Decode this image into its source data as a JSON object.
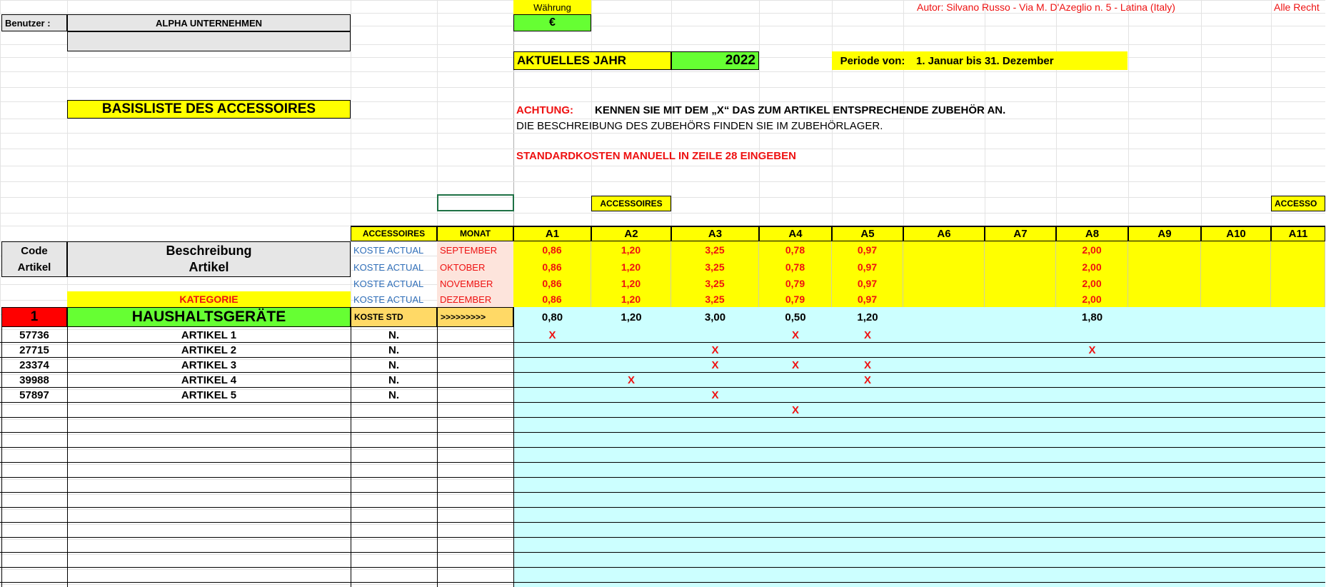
{
  "header": {
    "user_label": "Benutzer :",
    "company": "ALPHA UNTERNEHMEN",
    "currency_label": "Währung",
    "currency_value": "€",
    "author": "Autor: Silvano Russo - Via M. D'Azeglio n. 5 - Latina (Italy)",
    "rights": "Alle Recht",
    "year_label": "AKTUELLES JAHR",
    "year_value": "2022",
    "period_label": "Periode von:",
    "period_value": "1. Januar bis 31. Dezember",
    "list_title": "BASISLISTE DES ACCESSOIRES",
    "warning_label": "ACHTUNG:",
    "warning_text": "KENNEN SIE MIT DEM „X“ DAS ZUM ARTIKEL ENTSPRECHENDE ZUBEHÖR AN.",
    "info_text": "DIE BESCHREIBUNG DES ZUBEHÖRS FINDEN SIE IM ZUBEHÖRLAGER.",
    "std_cost_note": "STANDARDKOSTEN MANUELL IN ZEILE 28 EINGEBEN",
    "accessories_tag": "ACCESSOIRES",
    "accessories_tag_2": "ACCESSO"
  },
  "table": {
    "code_header_1": "Code",
    "code_header_2": "Artikel",
    "desc_header_1": "Beschreibung",
    "desc_header_2": "Artikel",
    "acc_header": "ACCESSOIRES",
    "month_header": "MONAT",
    "category_label": "KATEGORIE",
    "category_num": "1",
    "category_name": "HAUSHALTSGERÄTE",
    "std_label": "KOSTE STD",
    "std_arrow": ">>>>>>>>>",
    "acc_cols": [
      "A1",
      "A2",
      "A3",
      "A4",
      "A5",
      "A6",
      "A7",
      "A8",
      "A9",
      "A10",
      "A11"
    ],
    "cost_rows": [
      {
        "type": "KOSTE ACTUAL",
        "month": "SEPTEMBER",
        "values": [
          "0,86",
          "1,20",
          "3,25",
          "0,78",
          "0,97",
          "",
          "",
          "2,00",
          "",
          "",
          ""
        ]
      },
      {
        "type": "KOSTE ACTUAL",
        "month": "OKTOBER",
        "values": [
          "0,86",
          "1,20",
          "3,25",
          "0,78",
          "0,97",
          "",
          "",
          "2,00",
          "",
          "",
          ""
        ]
      },
      {
        "type": "KOSTE ACTUAL",
        "month": "NOVEMBER",
        "values": [
          "0,86",
          "1,20",
          "3,25",
          "0,79",
          "0,97",
          "",
          "",
          "2,00",
          "",
          "",
          ""
        ]
      },
      {
        "type": "KOSTE ACTUAL",
        "month": "DEZEMBER",
        "values": [
          "0,86",
          "1,20",
          "3,25",
          "0,79",
          "0,97",
          "",
          "",
          "2,00",
          "",
          "",
          ""
        ]
      }
    ],
    "std_values": [
      "0,80",
      "1,20",
      "3,00",
      "0,50",
      "1,20",
      "",
      "",
      "1,80",
      "",
      "",
      ""
    ],
    "articles": [
      {
        "code": "57736",
        "name": "ARTIKEL 1",
        "acc": "N.",
        "marks": [
          0,
          3,
          4
        ]
      },
      {
        "code": "27715",
        "name": "ARTIKEL 2",
        "acc": "N.",
        "marks": [
          2,
          7
        ]
      },
      {
        "code": "23374",
        "name": "ARTIKEL 3",
        "acc": "N.",
        "marks": [
          2,
          3,
          4
        ]
      },
      {
        "code": "39988",
        "name": "ARTIKEL 4",
        "acc": "N.",
        "marks": [
          1,
          4
        ]
      },
      {
        "code": "57897",
        "name": "ARTIKEL 5",
        "acc": "N.",
        "marks": [
          2
        ]
      },
      {
        "code": "",
        "name": "",
        "acc": "",
        "marks": [
          3
        ]
      }
    ],
    "mark_symbol": "X"
  }
}
